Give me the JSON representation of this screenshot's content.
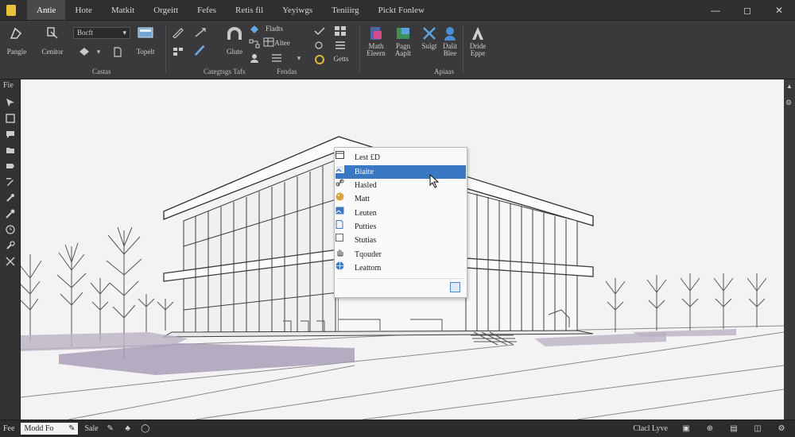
{
  "menu": {
    "items": [
      {
        "label": "Antie",
        "active": true
      },
      {
        "label": "Hote"
      },
      {
        "label": "Matkit"
      },
      {
        "label": "Orgeitt"
      },
      {
        "label": "Fefes"
      },
      {
        "label": "Retis fil"
      },
      {
        "label": "Yeyiwgs"
      },
      {
        "label": "Teniiirg"
      },
      {
        "label": "Pickt Fonlew"
      }
    ]
  },
  "window": {
    "minimize": "—",
    "restore": "◻",
    "close": "✕"
  },
  "ribbon": {
    "dropdown_value": "Bocft",
    "buttons": {
      "pangle": "Pangle",
      "contour": "Cenitor",
      "topel": "Topelt",
      "glute": "Glute",
      "fladts": "Fladts",
      "altee": "Altee",
      "gettt": "Getts",
      "math_elem": "Math Eleern",
      "pagn_aaplt": "Pagn Aaplt",
      "sulgt": "Sulgt",
      "dalit_blee": "Dalit Blee",
      "dride_eppe": "Dride Eppe"
    },
    "groups": {
      "castas": "Castas",
      "categs_tafs": "Categtsgs Tafs",
      "fendas": "Fendas",
      "apiaas": "Apiaas"
    }
  },
  "left_toolbar": {
    "label": "Fie"
  },
  "context_menu": {
    "items": [
      {
        "label": "Lest £D",
        "icon": "window-icon"
      },
      {
        "label": "Biaite",
        "icon": "image-icon",
        "selected": true
      },
      {
        "label": "Hasled",
        "icon": "link-icon"
      },
      {
        "label": "Matt",
        "icon": "palette-icon"
      },
      {
        "label": "Leuten",
        "icon": "picture-icon"
      },
      {
        "label": "Putties",
        "icon": "document-icon"
      },
      {
        "label": "Stutias",
        "icon": "checkbox-icon"
      },
      {
        "label": "Tqouder",
        "icon": "hand-icon"
      },
      {
        "label": "Leattom",
        "icon": "globe-icon"
      }
    ]
  },
  "statusbar": {
    "label": "Fee",
    "field_value": "Modd Fo",
    "field_icon": "✎",
    "mode": "Sale",
    "right_text": "Clacl  Lyve"
  },
  "colors": {
    "accent": "#3a78c4",
    "canvas": "#f3f3f3"
  }
}
